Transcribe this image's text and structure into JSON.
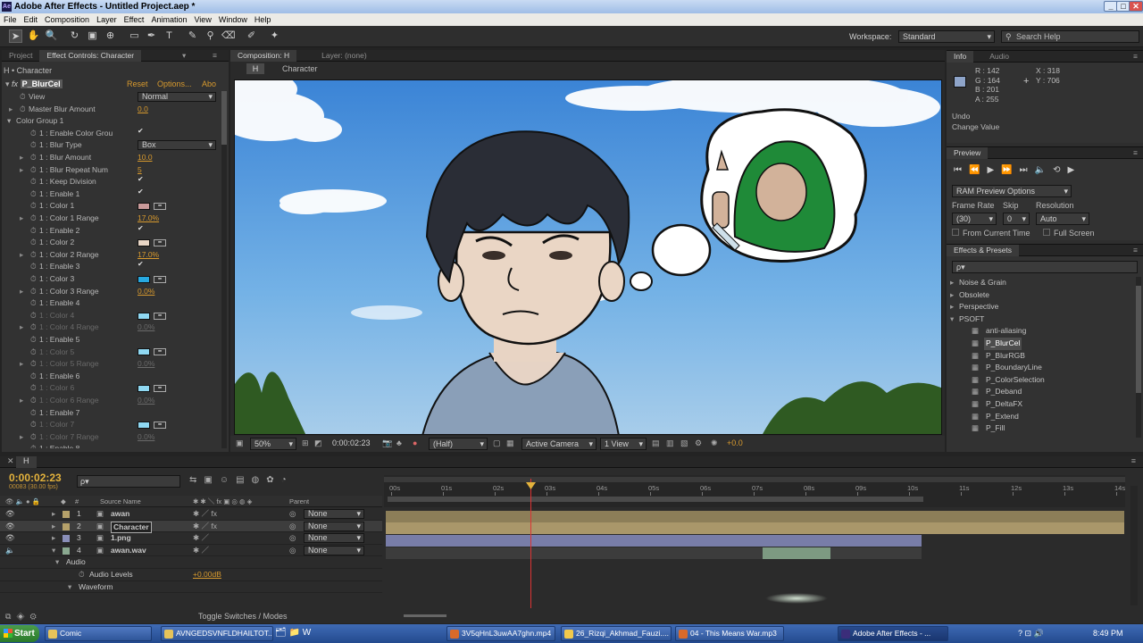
{
  "title": "Adobe After Effects - Untitled Project.aep *",
  "app_logo": "Ae",
  "window_controls": [
    "_",
    "□",
    "✕"
  ],
  "menu": [
    "File",
    "Edit",
    "Composition",
    "Layer",
    "Effect",
    "Animation",
    "View",
    "Window",
    "Help"
  ],
  "toolbar": {
    "workspace_label": "Workspace:",
    "workspace_value": "Standard",
    "search_placeholder": "Search Help"
  },
  "left_panel": {
    "tabs": [
      "Project",
      "Effect Controls: Character"
    ],
    "layer_path": "H • Character",
    "effect_name": "P_BlurCel",
    "reset": "Reset",
    "options": "Options...",
    "about": "Abo",
    "rows": [
      {
        "label": "View",
        "value": "Normal",
        "kind": "select",
        "indent": 1
      },
      {
        "label": "Master Blur Amount",
        "value": "0.0",
        "kind": "num",
        "indent": 1
      },
      {
        "label": "Color Group 1",
        "value": "",
        "kind": "group",
        "indent": 0
      },
      {
        "label": "1 : Enable Color Grou",
        "value": "✔",
        "kind": "chk",
        "indent": 2
      },
      {
        "label": "1 : Blur Type",
        "value": "Box",
        "kind": "select",
        "indent": 2
      },
      {
        "label": "1 : Blur Amount",
        "value": "10.0",
        "kind": "num",
        "indent": 2
      },
      {
        "label": "1 : Blur Repeat Num",
        "value": "5",
        "kind": "num",
        "indent": 2
      },
      {
        "label": "1 : Keep Division",
        "value": "✔",
        "kind": "chk",
        "indent": 2
      },
      {
        "label": "1 : Enable 1",
        "value": "✔",
        "kind": "chk",
        "indent": 2
      },
      {
        "label": "1 : Color 1",
        "value": "#c99a9a",
        "kind": "color",
        "indent": 2
      },
      {
        "label": "1 : Color 1 Range",
        "value": "17.0%",
        "kind": "num",
        "indent": 2
      },
      {
        "label": "1 : Enable 2",
        "value": "✔",
        "kind": "chk",
        "indent": 2
      },
      {
        "label": "1 : Color 2",
        "value": "#e8d6c6",
        "kind": "color",
        "indent": 2
      },
      {
        "label": "1 : Color 2 Range",
        "value": "17.0%",
        "kind": "num",
        "indent": 2
      },
      {
        "label": "1 : Enable 3",
        "value": "✔",
        "kind": "chk",
        "indent": 2
      },
      {
        "label": "1 : Color 3",
        "value": "#27a9e1",
        "kind": "color",
        "indent": 2
      },
      {
        "label": "1 : Color 3 Range",
        "value": "0.0%",
        "kind": "num",
        "indent": 2
      },
      {
        "label": "1 : Enable 4",
        "value": "",
        "kind": "chk",
        "indent": 2
      },
      {
        "label": "1 : Color 4",
        "value": "#8fd8f2",
        "kind": "color",
        "indent": 2,
        "dim": true
      },
      {
        "label": "1 : Color 4 Range",
        "value": "0.0%",
        "kind": "num",
        "indent": 2,
        "dim": true
      },
      {
        "label": "1 : Enable 5",
        "value": "",
        "kind": "chk",
        "indent": 2
      },
      {
        "label": "1 : Color 5",
        "value": "#8fd8f2",
        "kind": "color",
        "indent": 2,
        "dim": true
      },
      {
        "label": "1 : Color 5 Range",
        "value": "0.0%",
        "kind": "num",
        "indent": 2,
        "dim": true
      },
      {
        "label": "1 : Enable 6",
        "value": "",
        "kind": "chk",
        "indent": 2
      },
      {
        "label": "1 : Color 6",
        "value": "#8fd8f2",
        "kind": "color",
        "indent": 2,
        "dim": true
      },
      {
        "label": "1 : Color 6 Range",
        "value": "0.0%",
        "kind": "num",
        "indent": 2,
        "dim": true
      },
      {
        "label": "1 : Enable 7",
        "value": "",
        "kind": "chk",
        "indent": 2
      },
      {
        "label": "1 : Color 7",
        "value": "#8fd8f2",
        "kind": "color",
        "indent": 2,
        "dim": true
      },
      {
        "label": "1 : Color 7 Range",
        "value": "0.0%",
        "kind": "num",
        "indent": 2,
        "dim": true
      },
      {
        "label": "1 : Enable 8",
        "value": "",
        "kind": "chk",
        "indent": 2
      }
    ]
  },
  "comp_panel": {
    "tab": "Composition: H",
    "layer_tab": "Layer: (none)",
    "crumb_h": "H",
    "crumb_char": "Character",
    "zoom": "50%",
    "timecode": "0:00:02:23",
    "resolution": "(Half)",
    "camera": "Active Camera",
    "views": "1 View",
    "exposure": "+0.0"
  },
  "info": {
    "tabs": [
      "Info",
      "Audio"
    ],
    "rgba": [
      "R : 142",
      "G : 164",
      "B : 201",
      "A : 255"
    ],
    "x": "X : 318",
    "y": "Y : 706",
    "undo": "Undo",
    "last": "Change Value"
  },
  "preview": {
    "tab": "Preview",
    "ram": "RAM Preview Options",
    "frame_rate_label": "Frame Rate",
    "frame_rate": "(30)",
    "skip_label": "Skip",
    "skip": "0",
    "resolution_label": "Resolution",
    "resolution": "Auto",
    "from_current": "From Current Time",
    "full_screen": "Full Screen"
  },
  "effects": {
    "tab": "Effects & Presets",
    "search": "ρ▾",
    "items": [
      {
        "label": "Noise & Grain",
        "level": 0
      },
      {
        "label": "Obsolete",
        "level": 0
      },
      {
        "label": "Perspective",
        "level": 0
      },
      {
        "label": "PSOFT",
        "level": 0,
        "open": true
      },
      {
        "label": "anti-aliasing",
        "level": 1
      },
      {
        "label": "P_BlurCel",
        "level": 1,
        "selected": true
      },
      {
        "label": "P_BlurRGB",
        "level": 1
      },
      {
        "label": "P_BoundaryLine",
        "level": 1
      },
      {
        "label": "P_ColorSelection",
        "level": 1
      },
      {
        "label": "P_Deband",
        "level": 1
      },
      {
        "label": "P_DeltaFX",
        "level": 1
      },
      {
        "label": "P_Extend",
        "level": 1
      },
      {
        "label": "P_Fill",
        "level": 1
      }
    ]
  },
  "timeline": {
    "tab": "H",
    "timecode": "0:00:02:23",
    "frames": "00083 (30.00 fps)",
    "col_source": "Source Name",
    "col_parent": "Parent",
    "ruler": [
      "00s",
      "01s",
      "02s",
      "03s",
      "04s",
      "05s",
      "06s",
      "07s",
      "08s",
      "09s",
      "10s",
      "11s",
      "12s",
      "13s",
      "14s"
    ],
    "layers": [
      {
        "num": "1",
        "name": "awan",
        "parent": "None",
        "color": "#b5a16a"
      },
      {
        "num": "2",
        "name": "Character",
        "parent": "None",
        "color": "#b5a16a",
        "selected": true
      },
      {
        "num": "3",
        "name": "1.png",
        "parent": "None",
        "color": "#8a8fb8"
      },
      {
        "num": "4",
        "name": "awan.wav",
        "parent": "None",
        "color": "#8aa890"
      }
    ],
    "audio": "Audio",
    "audio_levels": "Audio Levels",
    "audio_levels_val": "+0.00dB",
    "waveform": "Waveform",
    "toggle": "Toggle Switches / Modes"
  },
  "taskbar": {
    "start": "Start",
    "items": [
      {
        "label": "Comic",
        "color": "#e6c35a"
      },
      {
        "label": "AVNGEDSVNFLDHAILTOT...",
        "color": "#e6c35a"
      },
      {
        "label": "3V5qHnL3uwAA7ghn.mp4",
        "color": "#d96a2a"
      },
      {
        "label": "26_Rizqi_Akhmad_Fauzi....",
        "color": "#f2c94c"
      },
      {
        "label": "04 - This Means War.mp3",
        "color": "#d96a2a"
      },
      {
        "label": "Adobe After Effects - ...",
        "color": "#3b2d7a",
        "active": true
      }
    ],
    "clock": "8:49 PM"
  }
}
